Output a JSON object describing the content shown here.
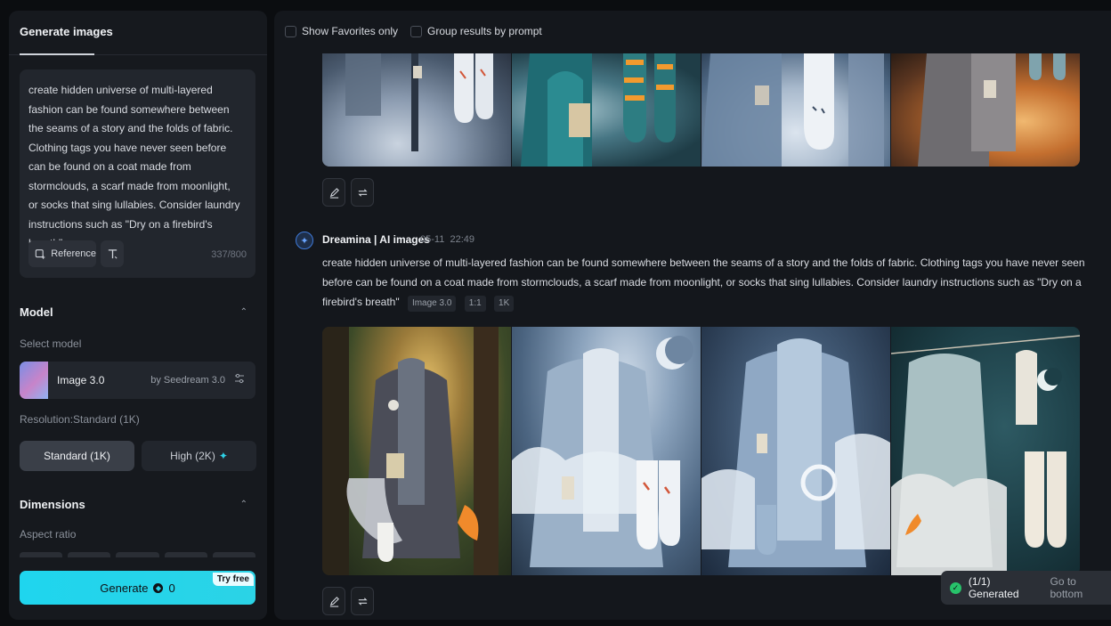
{
  "sidebar": {
    "tab_label": "Generate images",
    "prompt_text": "create hidden universe of multi-layered fashion can be found somewhere between the seams of a story and the folds of fabric. Clothing tags you have never seen before can be found on a coat made from stormclouds, a scarf made from moonlight, or socks that sing lullabies. Consider laundry instructions such as \"Dry on a firebird's breath\"",
    "reference_label": "Reference",
    "char_count": "337/800",
    "model_section": "Model",
    "select_model_label": "Select model",
    "model_name": "Image 3.0",
    "model_by": "by Seedream 3.0",
    "resolution_label": "Resolution:Standard (1K)",
    "res_standard": "Standard (1K)",
    "res_high": "High (2K)",
    "dimensions_section": "Dimensions",
    "aspect_ratio_label": "Aspect ratio",
    "generate_label": "Generate",
    "generate_cost": "0",
    "try_free": "Try free"
  },
  "results": {
    "filter_favorites": "Show Favorites only",
    "filter_group": "Group results by prompt",
    "message": {
      "author": "Dreamina | AI images",
      "date": "05-11",
      "time": "22:49",
      "prompt": "create hidden universe of multi-layered fashion can be found somewhere between the seams of a story and the folds of fabric. Clothing tags you have never seen before can be found on a coat made from stormclouds, a scarf made from moonlight, or socks that sing lullabies. Consider laundry instructions such as \"Dry on a firebird's breath\"",
      "tag_model": "Image 3.0",
      "tag_ratio": "1:1",
      "tag_res": "1K"
    }
  },
  "toast": {
    "status": "(1/1) Generated",
    "link": "Go to bottom"
  },
  "colors": {
    "accent": "#27d4ea",
    "success": "#27c26a",
    "panel": "#16191e"
  }
}
